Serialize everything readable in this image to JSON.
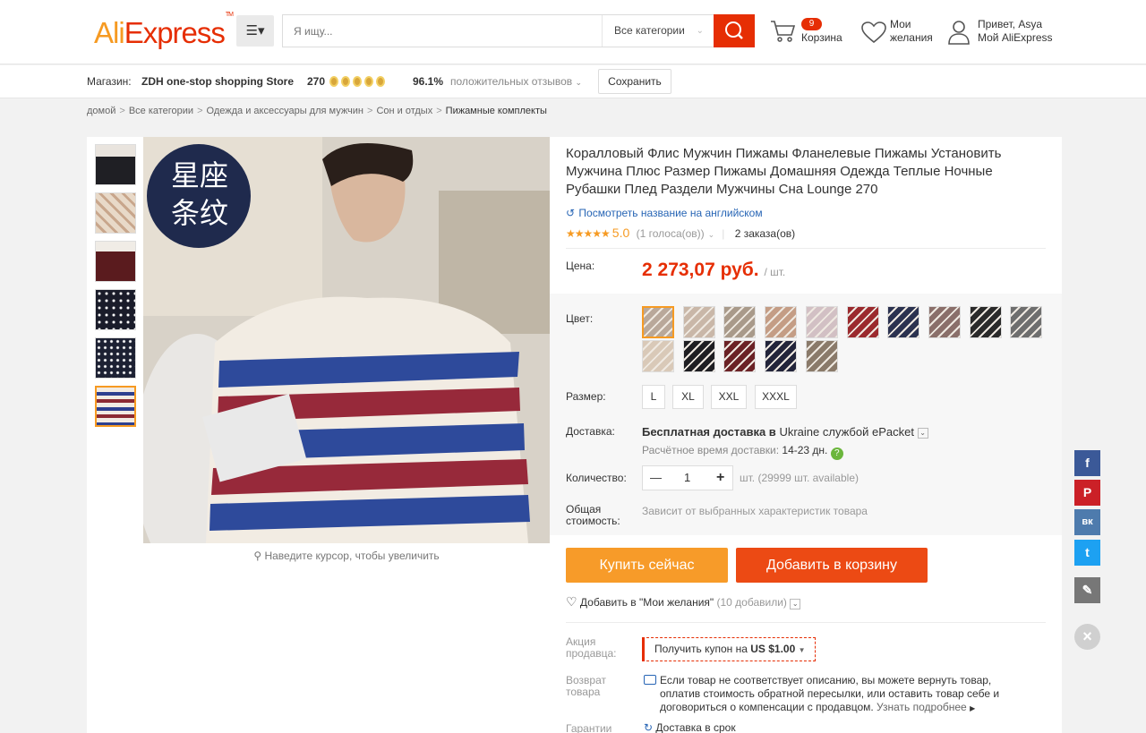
{
  "header": {
    "logo_main": "Ali",
    "logo_tail": "Express",
    "logo_tm": "TM",
    "search_placeholder": "Я ищу...",
    "category": "Все категории",
    "cart_count": "9",
    "cart_label": "Корзина",
    "wishlist_line1": "Мои",
    "wishlist_line2": "желания",
    "account_line1": "Привет, Asya",
    "account_line2": "Мой AliExpress"
  },
  "store": {
    "label": "Магазин:",
    "name": "ZDH one-stop shopping Store",
    "score": "270",
    "feedback_pct": "96.1%",
    "feedback_label": "положительных отзывов",
    "save": "Сохранить"
  },
  "breadcrumb": [
    "домой",
    "Все категории",
    "Одежда и аксессуары для мужчин",
    "Сон и отдых",
    "Пижамные комплекты"
  ],
  "image": {
    "badge_line1": "星座",
    "badge_line2": "条纹",
    "zoom_hint": "Наведите курсор, чтобы увеличить"
  },
  "product": {
    "title": "Коралловый Флис Мужчин Пижамы Фланелевые Пижамы Установить Мужчина Плюс Размер Пижамы Домашняя Одежда Теплые Ночные Рубашки Плед Раздели Мужчины Сна Lounge 270",
    "english_link": "Посмотреть название на английском",
    "rating_score": "5.0",
    "rating_votes": "(1 голоса(ов))",
    "orders": "2 заказа(ов)",
    "price_label": "Цена:",
    "price": "2 273,07 руб.",
    "price_unit": "/ шт.",
    "color_label": "Цвет:",
    "size_label": "Размер:",
    "sizes": [
      "L",
      "XL",
      "XXL",
      "XXXL"
    ],
    "delivery_label": "Доставка:",
    "delivery_bold": "Бесплатная доставка в",
    "delivery_country": "Ukraine",
    "delivery_service": "службой ePacket",
    "delivery_time_label": "Расчётное время доставки:",
    "delivery_time": "14-23 дн.",
    "qty_label": "Количество:",
    "qty_value": "1",
    "qty_avail": "шт. (29999 шт. available)",
    "total_label_1": "Общая",
    "total_label_2": "стоимость:",
    "total_value": "Зависит от выбранных характеристик товара",
    "buy_now": "Купить сейчас",
    "add_cart": "Добавить в корзину",
    "wishlist": "Добавить в \"Мои желания\"",
    "wishlist_count": "(10 добавили)",
    "promo_label_1": "Акция",
    "promo_label_2": "продавца:",
    "coupon_text": "Получить купон на",
    "coupon_amount": "US $1.00",
    "return_label_1": "Возврат",
    "return_label_2": "товара",
    "return_line1": "Если товар не соответствует описанию, вы можете вернуть товар,",
    "return_line2": "оплатив стоимость обратной пересылки, или оставить товар себе и",
    "return_line3": "договориться о компенсации с продавцом.",
    "return_more": "Узнать подробнее",
    "guarantee_label": "Гарантии",
    "guarantee_item": "Доставка в срок"
  },
  "swatch_colors": [
    "#b9a89a",
    "#c9b7a8",
    "#a99a8a",
    "#c49d85",
    "#d2c0c4",
    "#9b2a2e",
    "#2b3250",
    "#8a6f6a",
    "#2a2a2a",
    "#6e6e6e",
    "#d9c9b8",
    "#1e1e22",
    "#6b2226",
    "#22243a",
    "#8a7a6a"
  ],
  "social": [
    "f",
    "P",
    "вк",
    "t",
    "✎",
    "×"
  ],
  "colors": {
    "accent": "#e62e04",
    "orange": "#f69a22",
    "link": "#2765b5"
  }
}
